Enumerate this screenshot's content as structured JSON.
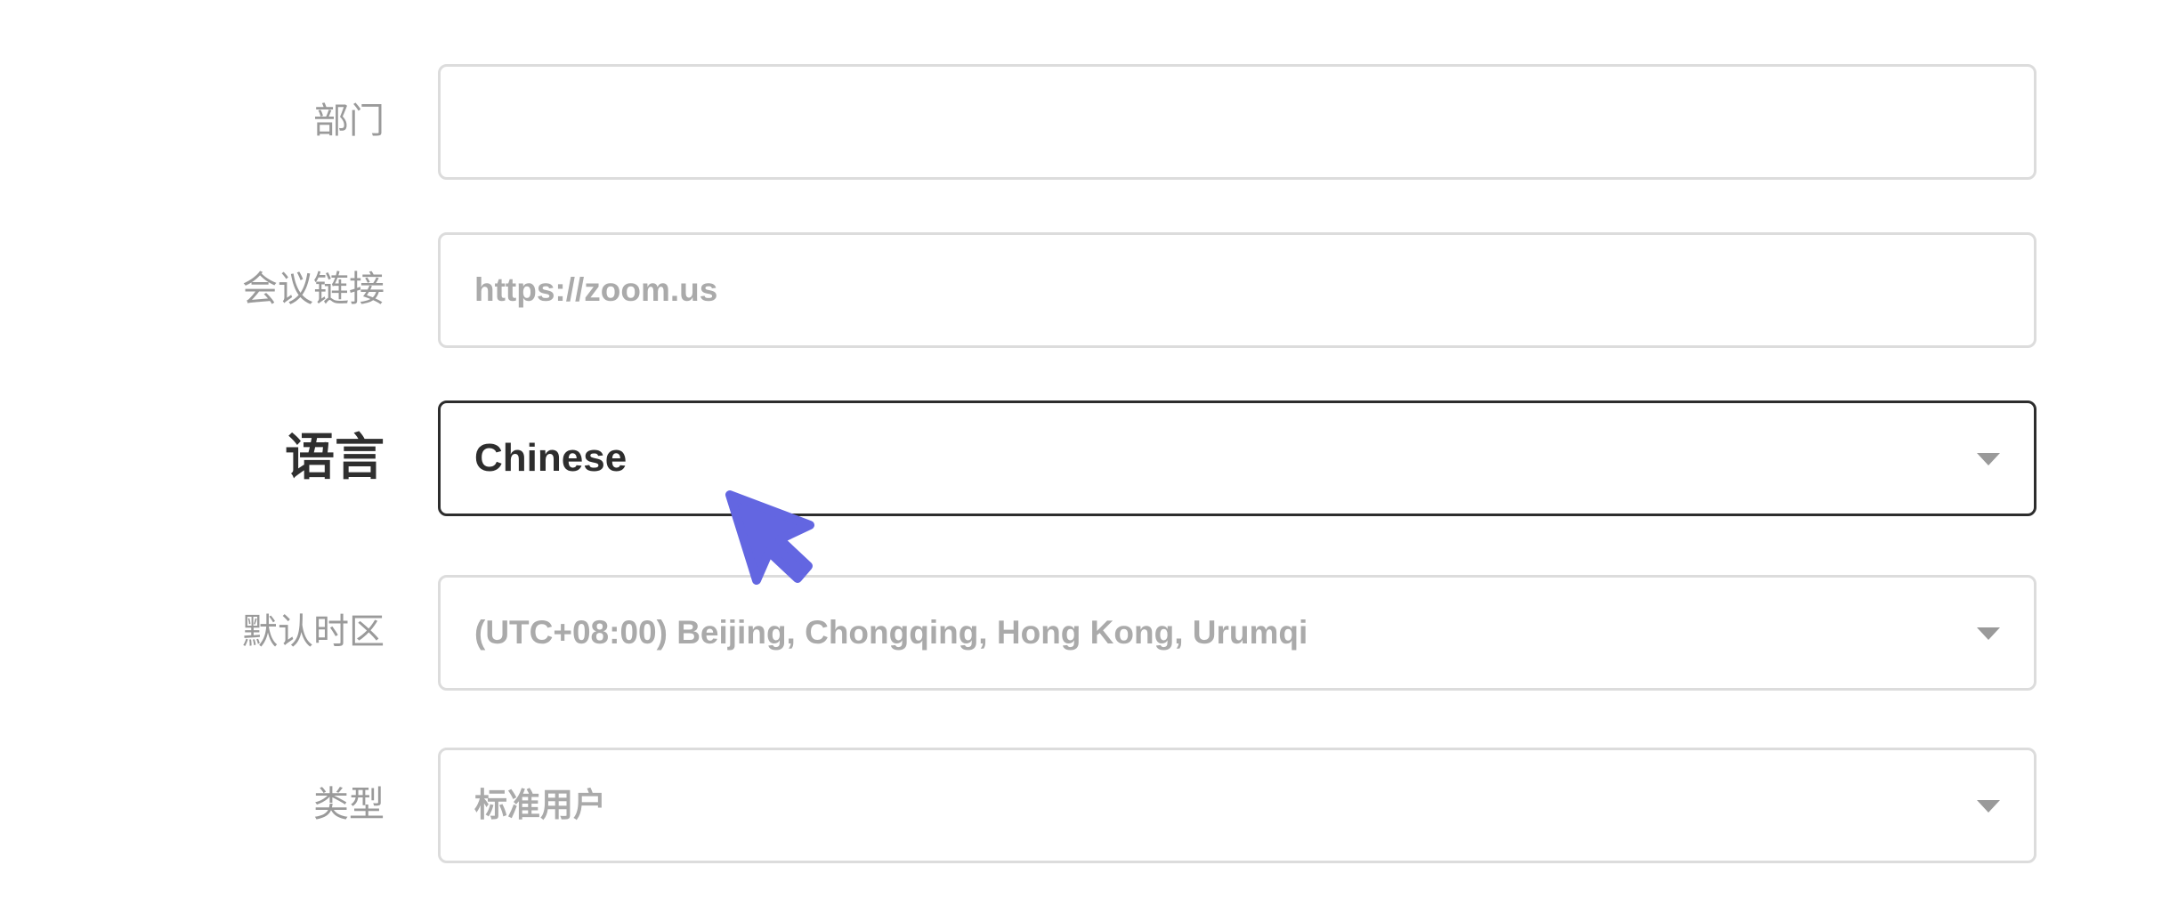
{
  "form": {
    "department": {
      "label": "部门",
      "value": "",
      "placeholder": ""
    },
    "meeting_link": {
      "label": "会议链接",
      "value": "",
      "placeholder": "https://zoom.us"
    },
    "language": {
      "label": "语言",
      "value": "Chinese"
    },
    "timezone": {
      "label": "默认时区",
      "value": "(UTC+08:00) Beijing, Chongqing, Hong Kong, Urumqi"
    },
    "type": {
      "label": "类型",
      "value": "标准用户"
    }
  },
  "icons": {
    "dropdown": "chevron-down-icon",
    "pointer": "mouse-pointer-icon"
  },
  "colors": {
    "label_muted": "#9a9a9a",
    "label_active": "#2f2f2f",
    "border_default": "#dcdcdc",
    "border_active": "#2d2d2d",
    "cursor": "#6366e1"
  }
}
